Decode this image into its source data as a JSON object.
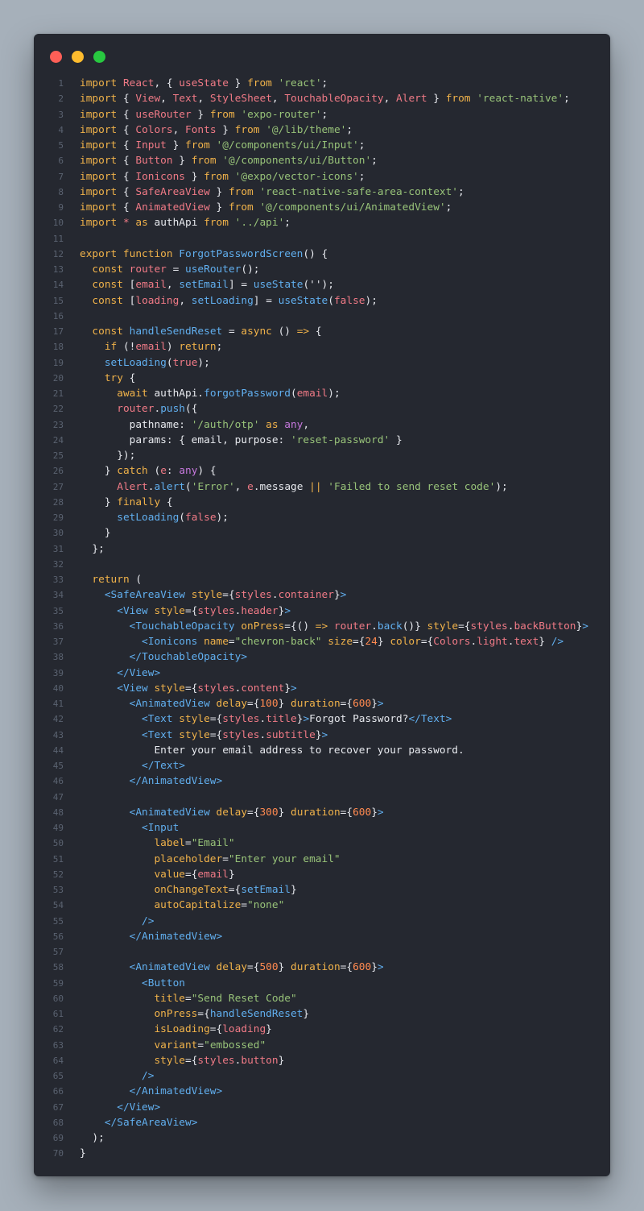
{
  "window": {
    "controls": [
      {
        "name": "close-dot",
        "color": "#ff5f57"
      },
      {
        "name": "minimize-dot",
        "color": "#febc2e"
      },
      {
        "name": "zoom-dot",
        "color": "#28c840"
      }
    ]
  },
  "code_lines": [
    [
      [
        "kw",
        "import "
      ],
      [
        "id",
        "React"
      ],
      [
        "pl",
        ", { "
      ],
      [
        "id",
        "useState"
      ],
      [
        "pl",
        " } "
      ],
      [
        "kw",
        "from "
      ],
      [
        "st",
        "'react'"
      ],
      [
        "pl",
        ";"
      ]
    ],
    [
      [
        "kw",
        "import "
      ],
      [
        "pl",
        "{ "
      ],
      [
        "id",
        "View"
      ],
      [
        "pl",
        ", "
      ],
      [
        "id",
        "Text"
      ],
      [
        "pl",
        ", "
      ],
      [
        "id",
        "StyleSheet"
      ],
      [
        "pl",
        ", "
      ],
      [
        "id",
        "TouchableOpacity"
      ],
      [
        "pl",
        ", "
      ],
      [
        "id",
        "Alert"
      ],
      [
        "pl",
        " } "
      ],
      [
        "kw",
        "from "
      ],
      [
        "st",
        "'react-native'"
      ],
      [
        "pl",
        ";"
      ]
    ],
    [
      [
        "kw",
        "import "
      ],
      [
        "pl",
        "{ "
      ],
      [
        "id",
        "useRouter"
      ],
      [
        "pl",
        " } "
      ],
      [
        "kw",
        "from "
      ],
      [
        "st",
        "'expo-router'"
      ],
      [
        "pl",
        ";"
      ]
    ],
    [
      [
        "kw",
        "import "
      ],
      [
        "pl",
        "{ "
      ],
      [
        "id",
        "Colors"
      ],
      [
        "pl",
        ", "
      ],
      [
        "id",
        "Fonts"
      ],
      [
        "pl",
        " } "
      ],
      [
        "kw",
        "from "
      ],
      [
        "st",
        "'@/lib/theme'"
      ],
      [
        "pl",
        ";"
      ]
    ],
    [
      [
        "kw",
        "import "
      ],
      [
        "pl",
        "{ "
      ],
      [
        "id",
        "Input"
      ],
      [
        "pl",
        " } "
      ],
      [
        "kw",
        "from "
      ],
      [
        "st",
        "'@/components/ui/Input'"
      ],
      [
        "pl",
        ";"
      ]
    ],
    [
      [
        "kw",
        "import "
      ],
      [
        "pl",
        "{ "
      ],
      [
        "id",
        "Button"
      ],
      [
        "pl",
        " } "
      ],
      [
        "kw",
        "from "
      ],
      [
        "st",
        "'@/components/ui/Button'"
      ],
      [
        "pl",
        ";"
      ]
    ],
    [
      [
        "kw",
        "import "
      ],
      [
        "pl",
        "{ "
      ],
      [
        "id",
        "Ionicons"
      ],
      [
        "pl",
        " } "
      ],
      [
        "kw",
        "from "
      ],
      [
        "st",
        "'@expo/vector-icons'"
      ],
      [
        "pl",
        ";"
      ]
    ],
    [
      [
        "kw",
        "import "
      ],
      [
        "pl",
        "{ "
      ],
      [
        "id",
        "SafeAreaView"
      ],
      [
        "pl",
        " } "
      ],
      [
        "kw",
        "from "
      ],
      [
        "st",
        "'react-native-safe-area-context'"
      ],
      [
        "pl",
        ";"
      ]
    ],
    [
      [
        "kw",
        "import "
      ],
      [
        "pl",
        "{ "
      ],
      [
        "id",
        "AnimatedView"
      ],
      [
        "pl",
        " } "
      ],
      [
        "kw",
        "from "
      ],
      [
        "st",
        "'@/components/ui/AnimatedView'"
      ],
      [
        "pl",
        ";"
      ]
    ],
    [
      [
        "kw",
        "import "
      ],
      [
        "id",
        "* "
      ],
      [
        "kw",
        "as "
      ],
      [
        "pl",
        "authApi "
      ],
      [
        "kw",
        "from "
      ],
      [
        "st",
        "'../api'"
      ],
      [
        "pl",
        ";"
      ]
    ],
    [],
    [
      [
        "kw",
        "export function "
      ],
      [
        "fn",
        "ForgotPasswordScreen"
      ],
      [
        "pl",
        "() {"
      ]
    ],
    [
      [
        "pl",
        "  "
      ],
      [
        "kw",
        "const "
      ],
      [
        "id",
        "router"
      ],
      [
        "pl",
        " = "
      ],
      [
        "fn",
        "useRouter"
      ],
      [
        "pl",
        "();"
      ]
    ],
    [
      [
        "pl",
        "  "
      ],
      [
        "kw",
        "const "
      ],
      [
        "pl",
        "["
      ],
      [
        "id",
        "email"
      ],
      [
        "pl",
        ", "
      ],
      [
        "fn",
        "setEmail"
      ],
      [
        "pl",
        "] = "
      ],
      [
        "fn",
        "useState"
      ],
      [
        "pl",
        "('');"
      ]
    ],
    [
      [
        "pl",
        "  "
      ],
      [
        "kw",
        "const "
      ],
      [
        "pl",
        "["
      ],
      [
        "id",
        "loading"
      ],
      [
        "pl",
        ", "
      ],
      [
        "fn",
        "setLoading"
      ],
      [
        "pl",
        "] = "
      ],
      [
        "fn",
        "useState"
      ],
      [
        "pl",
        "("
      ],
      [
        "id",
        "false"
      ],
      [
        "pl",
        ");"
      ]
    ],
    [],
    [
      [
        "pl",
        "  "
      ],
      [
        "kw",
        "const "
      ],
      [
        "fn",
        "handleSendReset"
      ],
      [
        "pl",
        " = "
      ],
      [
        "kw",
        "async "
      ],
      [
        "pl",
        "() "
      ],
      [
        "kw",
        "=> "
      ],
      [
        "pl",
        "{"
      ]
    ],
    [
      [
        "pl",
        "    "
      ],
      [
        "kw",
        "if "
      ],
      [
        "pl",
        "(!"
      ],
      [
        "id",
        "email"
      ],
      [
        "pl",
        ") "
      ],
      [
        "kw",
        "return"
      ],
      [
        "pl",
        ";"
      ]
    ],
    [
      [
        "pl",
        "    "
      ],
      [
        "fn",
        "setLoading"
      ],
      [
        "pl",
        "("
      ],
      [
        "id",
        "true"
      ],
      [
        "pl",
        ");"
      ]
    ],
    [
      [
        "pl",
        "    "
      ],
      [
        "kw",
        "try "
      ],
      [
        "pl",
        "{"
      ]
    ],
    [
      [
        "pl",
        "      "
      ],
      [
        "kw",
        "await "
      ],
      [
        "pl",
        "authApi."
      ],
      [
        "fn",
        "forgotPassword"
      ],
      [
        "pl",
        "("
      ],
      [
        "id",
        "email"
      ],
      [
        "pl",
        ");"
      ]
    ],
    [
      [
        "pl",
        "      "
      ],
      [
        "id",
        "router"
      ],
      [
        "pl",
        "."
      ],
      [
        "fn",
        "push"
      ],
      [
        "pl",
        "({"
      ]
    ],
    [
      [
        "pl",
        "        pathname: "
      ],
      [
        "st",
        "'/auth/otp'"
      ],
      [
        "kw",
        " as "
      ],
      [
        "pu",
        "any"
      ],
      [
        "pl",
        ","
      ]
    ],
    [
      [
        "pl",
        "        params: { email, purpose: "
      ],
      [
        "st",
        "'reset-password'"
      ],
      [
        "pl",
        " }"
      ]
    ],
    [
      [
        "pl",
        "      });"
      ]
    ],
    [
      [
        "pl",
        "    } "
      ],
      [
        "kw",
        "catch "
      ],
      [
        "pl",
        "("
      ],
      [
        "id",
        "e"
      ],
      [
        "pl",
        ": "
      ],
      [
        "pu",
        "any"
      ],
      [
        "pl",
        ") {"
      ]
    ],
    [
      [
        "pl",
        "      "
      ],
      [
        "id",
        "Alert"
      ],
      [
        "pl",
        "."
      ],
      [
        "fn",
        "alert"
      ],
      [
        "pl",
        "("
      ],
      [
        "st",
        "'Error'"
      ],
      [
        "pl",
        ", "
      ],
      [
        "id",
        "e"
      ],
      [
        "pl",
        ".message "
      ],
      [
        "kw",
        "|| "
      ],
      [
        "st",
        "'Failed to send reset code'"
      ],
      [
        "pl",
        ");"
      ]
    ],
    [
      [
        "pl",
        "    } "
      ],
      [
        "kw",
        "finally "
      ],
      [
        "pl",
        "{"
      ]
    ],
    [
      [
        "pl",
        "      "
      ],
      [
        "fn",
        "setLoading"
      ],
      [
        "pl",
        "("
      ],
      [
        "id",
        "false"
      ],
      [
        "pl",
        ");"
      ]
    ],
    [
      [
        "pl",
        "    }"
      ]
    ],
    [
      [
        "pl",
        "  };"
      ]
    ],
    [],
    [
      [
        "pl",
        "  "
      ],
      [
        "kw",
        "return "
      ],
      [
        "pl",
        "("
      ]
    ],
    [
      [
        "pl",
        "    "
      ],
      [
        "tg",
        "<SafeAreaView "
      ],
      [
        "kw",
        "style"
      ],
      [
        "pl",
        "={"
      ],
      [
        "id",
        "styles"
      ],
      [
        "pl",
        "."
      ],
      [
        "id",
        "container"
      ],
      [
        "pl",
        "}"
      ],
      [
        "tg",
        ">"
      ]
    ],
    [
      [
        "pl",
        "      "
      ],
      [
        "tg",
        "<View "
      ],
      [
        "kw",
        "style"
      ],
      [
        "pl",
        "={"
      ],
      [
        "id",
        "styles"
      ],
      [
        "pl",
        "."
      ],
      [
        "id",
        "header"
      ],
      [
        "pl",
        "}"
      ],
      [
        "tg",
        ">"
      ]
    ],
    [
      [
        "pl",
        "        "
      ],
      [
        "tg",
        "<TouchableOpacity "
      ],
      [
        "kw",
        "onPress"
      ],
      [
        "pl",
        "={() "
      ],
      [
        "kw",
        "=> "
      ],
      [
        "id",
        "router"
      ],
      [
        "pl",
        "."
      ],
      [
        "fn",
        "back"
      ],
      [
        "pl",
        "()} "
      ],
      [
        "kw",
        "style"
      ],
      [
        "pl",
        "={"
      ],
      [
        "id",
        "styles"
      ],
      [
        "pl",
        "."
      ],
      [
        "id",
        "backButton"
      ],
      [
        "pl",
        "}"
      ],
      [
        "tg",
        ">"
      ]
    ],
    [
      [
        "pl",
        "          "
      ],
      [
        "tg",
        "<Ionicons "
      ],
      [
        "kw",
        "name"
      ],
      [
        "pl",
        "="
      ],
      [
        "st",
        "\"chevron-back\""
      ],
      [
        "kw",
        " size"
      ],
      [
        "pl",
        "={"
      ],
      [
        "nm",
        "24"
      ],
      [
        "pl",
        "} "
      ],
      [
        "kw",
        "color"
      ],
      [
        "pl",
        "={"
      ],
      [
        "id",
        "Colors"
      ],
      [
        "pl",
        "."
      ],
      [
        "id",
        "light"
      ],
      [
        "pl",
        "."
      ],
      [
        "id",
        "text"
      ],
      [
        "pl",
        "} "
      ],
      [
        "tg",
        "/>"
      ]
    ],
    [
      [
        "pl",
        "        "
      ],
      [
        "tg",
        "</TouchableOpacity>"
      ]
    ],
    [
      [
        "pl",
        "      "
      ],
      [
        "tg",
        "</View>"
      ]
    ],
    [
      [
        "pl",
        "      "
      ],
      [
        "tg",
        "<View "
      ],
      [
        "kw",
        "style"
      ],
      [
        "pl",
        "={"
      ],
      [
        "id",
        "styles"
      ],
      [
        "pl",
        "."
      ],
      [
        "id",
        "content"
      ],
      [
        "pl",
        "}"
      ],
      [
        "tg",
        ">"
      ]
    ],
    [
      [
        "pl",
        "        "
      ],
      [
        "tg",
        "<AnimatedView "
      ],
      [
        "kw",
        "delay"
      ],
      [
        "pl",
        "={"
      ],
      [
        "nm",
        "100"
      ],
      [
        "pl",
        "} "
      ],
      [
        "kw",
        "duration"
      ],
      [
        "pl",
        "={"
      ],
      [
        "nm",
        "600"
      ],
      [
        "pl",
        "}"
      ],
      [
        "tg",
        ">"
      ]
    ],
    [
      [
        "pl",
        "          "
      ],
      [
        "tg",
        "<Text "
      ],
      [
        "kw",
        "style"
      ],
      [
        "pl",
        "={"
      ],
      [
        "id",
        "styles"
      ],
      [
        "pl",
        "."
      ],
      [
        "id",
        "title"
      ],
      [
        "pl",
        "}"
      ],
      [
        "tg",
        ">"
      ],
      [
        "pl",
        "Forgot Password?"
      ],
      [
        "tg",
        "</Text>"
      ]
    ],
    [
      [
        "pl",
        "          "
      ],
      [
        "tg",
        "<Text "
      ],
      [
        "kw",
        "style"
      ],
      [
        "pl",
        "={"
      ],
      [
        "id",
        "styles"
      ],
      [
        "pl",
        "."
      ],
      [
        "id",
        "subtitle"
      ],
      [
        "pl",
        "}"
      ],
      [
        "tg",
        ">"
      ]
    ],
    [
      [
        "pl",
        "            Enter your email address to recover your password."
      ]
    ],
    [
      [
        "pl",
        "          "
      ],
      [
        "tg",
        "</Text>"
      ]
    ],
    [
      [
        "pl",
        "        "
      ],
      [
        "tg",
        "</AnimatedView>"
      ]
    ],
    [],
    [
      [
        "pl",
        "        "
      ],
      [
        "tg",
        "<AnimatedView "
      ],
      [
        "kw",
        "delay"
      ],
      [
        "pl",
        "={"
      ],
      [
        "nm",
        "300"
      ],
      [
        "pl",
        "} "
      ],
      [
        "kw",
        "duration"
      ],
      [
        "pl",
        "={"
      ],
      [
        "nm",
        "600"
      ],
      [
        "pl",
        "}"
      ],
      [
        "tg",
        ">"
      ]
    ],
    [
      [
        "pl",
        "          "
      ],
      [
        "tg",
        "<Input"
      ]
    ],
    [
      [
        "pl",
        "            "
      ],
      [
        "kw",
        "label"
      ],
      [
        "pl",
        "="
      ],
      [
        "st",
        "\"Email\""
      ]
    ],
    [
      [
        "pl",
        "            "
      ],
      [
        "kw",
        "placeholder"
      ],
      [
        "pl",
        "="
      ],
      [
        "st",
        "\"Enter your email\""
      ]
    ],
    [
      [
        "pl",
        "            "
      ],
      [
        "kw",
        "value"
      ],
      [
        "pl",
        "={"
      ],
      [
        "id",
        "email"
      ],
      [
        "pl",
        "}"
      ]
    ],
    [
      [
        "pl",
        "            "
      ],
      [
        "kw",
        "onChangeText"
      ],
      [
        "pl",
        "={"
      ],
      [
        "fn",
        "setEmail"
      ],
      [
        "pl",
        "}"
      ]
    ],
    [
      [
        "pl",
        "            "
      ],
      [
        "kw",
        "autoCapitalize"
      ],
      [
        "pl",
        "="
      ],
      [
        "st",
        "\"none\""
      ]
    ],
    [
      [
        "pl",
        "          "
      ],
      [
        "tg",
        "/>"
      ]
    ],
    [
      [
        "pl",
        "        "
      ],
      [
        "tg",
        "</AnimatedView>"
      ]
    ],
    [],
    [
      [
        "pl",
        "        "
      ],
      [
        "tg",
        "<AnimatedView "
      ],
      [
        "kw",
        "delay"
      ],
      [
        "pl",
        "={"
      ],
      [
        "nm",
        "500"
      ],
      [
        "pl",
        "} "
      ],
      [
        "kw",
        "duration"
      ],
      [
        "pl",
        "={"
      ],
      [
        "nm",
        "600"
      ],
      [
        "pl",
        "}"
      ],
      [
        "tg",
        ">"
      ]
    ],
    [
      [
        "pl",
        "          "
      ],
      [
        "tg",
        "<Button"
      ]
    ],
    [
      [
        "pl",
        "            "
      ],
      [
        "kw",
        "title"
      ],
      [
        "pl",
        "="
      ],
      [
        "st",
        "\"Send Reset Code\""
      ]
    ],
    [
      [
        "pl",
        "            "
      ],
      [
        "kw",
        "onPress"
      ],
      [
        "pl",
        "={"
      ],
      [
        "fn",
        "handleSendReset"
      ],
      [
        "pl",
        "}"
      ]
    ],
    [
      [
        "pl",
        "            "
      ],
      [
        "kw",
        "isLoading"
      ],
      [
        "pl",
        "={"
      ],
      [
        "id",
        "loading"
      ],
      [
        "pl",
        "}"
      ]
    ],
    [
      [
        "pl",
        "            "
      ],
      [
        "kw",
        "variant"
      ],
      [
        "pl",
        "="
      ],
      [
        "st",
        "\"embossed\""
      ]
    ],
    [
      [
        "pl",
        "            "
      ],
      [
        "kw",
        "style"
      ],
      [
        "pl",
        "={"
      ],
      [
        "id",
        "styles"
      ],
      [
        "pl",
        "."
      ],
      [
        "id",
        "button"
      ],
      [
        "pl",
        "}"
      ]
    ],
    [
      [
        "pl",
        "          "
      ],
      [
        "tg",
        "/>"
      ]
    ],
    [
      [
        "pl",
        "        "
      ],
      [
        "tg",
        "</AnimatedView>"
      ]
    ],
    [
      [
        "pl",
        "      "
      ],
      [
        "tg",
        "</View>"
      ]
    ],
    [
      [
        "pl",
        "    "
      ],
      [
        "tg",
        "</SafeAreaView>"
      ]
    ],
    [
      [
        "pl",
        "  );"
      ]
    ],
    [
      [
        "pl",
        "}"
      ]
    ]
  ]
}
